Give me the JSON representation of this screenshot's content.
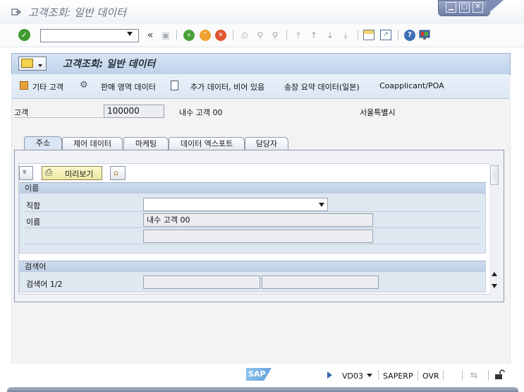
{
  "window": {
    "title": "고객조회: 일반 데이터",
    "controls": [
      "minimize",
      "restore",
      "close"
    ]
  },
  "toolbar": {
    "command_value": "",
    "icons": [
      "check-icon",
      "dropdown-arrow-icon",
      "back-chevrons-icon",
      "save-icon",
      "back-green-icon",
      "exit-orange-icon",
      "cancel-red-icon",
      "print-icon",
      "find-icon",
      "find-next-icon",
      "first-page-icon",
      "prev-page-icon",
      "next-page-icon",
      "last-page-icon",
      "new-session-icon",
      "shortcut-icon",
      "help-icon",
      "settings-monitor-icon"
    ]
  },
  "header": {
    "title": "고객조회: 일반 데이터"
  },
  "app_toolbar": {
    "items": [
      {
        "label": "기타 고객",
        "icon": "other-customer-icon"
      },
      {
        "label": "판매 영역 데이터",
        "icon": "sales-area-icon"
      },
      {
        "label": "추가 데이터, 비어 있음",
        "icon": "additional-data-icon"
      },
      {
        "label": "송장 요약 데이터(일본)",
        "icon": ""
      },
      {
        "label": "Coapplicant/POA",
        "icon": ""
      }
    ]
  },
  "customer": {
    "label": "고객",
    "value": "100000",
    "name": "내수 고객 00",
    "city": "서울특별시"
  },
  "tabs": [
    {
      "label": "주소",
      "active": true
    },
    {
      "label": "제어 데이터",
      "active": false
    },
    {
      "label": "마케팅",
      "active": false
    },
    {
      "label": "데이터 엑스포트",
      "active": false
    },
    {
      "label": "담당자",
      "active": false
    }
  ],
  "panel": {
    "preview_label": "미리보기",
    "name_group": {
      "title": "이름",
      "title_field_label": "직함",
      "title_field_value": "",
      "name_label": "이름",
      "name_value": "내수 고객 00",
      "name2_value": ""
    },
    "search_group": {
      "title": "검색어",
      "search_label": "검색어 1/2",
      "search1_value": "",
      "search2_value": ""
    }
  },
  "statusbar": {
    "brand": "SAP",
    "tcode": "VD03",
    "system": "SAPERP",
    "mode": "OVR"
  },
  "colors": {
    "header_blue": "#c8d8ee",
    "button_yellow": "#f7f3b8",
    "window_controls": "#7d8cb3"
  }
}
